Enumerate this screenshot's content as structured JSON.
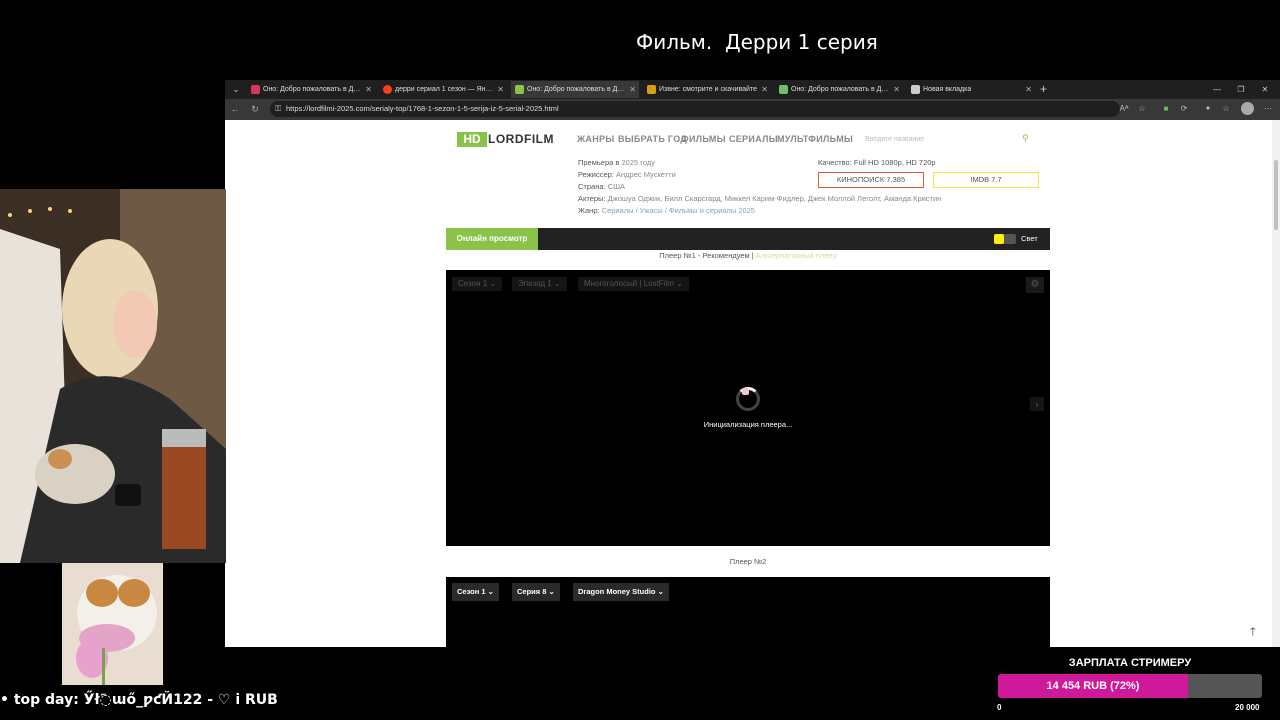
{
  "stream": {
    "title": "Фильм.  Дерри 1 серия",
    "top_day": "• top day: Ӳł߬ɯő_ƿƈЙ122 - ♡ i RUB"
  },
  "browser": {
    "tabs": [
      {
        "label": "Оно: Добро пожаловать в Дерри",
        "favicon_color": "#d9345a"
      },
      {
        "label": "дерри сериал 1 сезон — Яндекс",
        "favicon_color": "#fc3f1d"
      },
      {
        "label": "Оно: Добро пожаловать в Дерри",
        "favicon_color": "#8bc34a",
        "active": true
      },
      {
        "label": "Извне: смотрите и скачивайте",
        "favicon_color": "#d4a017"
      },
      {
        "label": "Оно: Добро пожаловать в Дерри",
        "favicon_color": "#6ec06e"
      },
      {
        "label": "Новая вкладка",
        "favicon_color": "#cccccc"
      }
    ],
    "url": "https://lordfilmi-2025.com/serialy-top/1768-1-sezon-1-5-serija-iz-5-serial-2025.html",
    "icons": [
      "back-icon",
      "reload-icon",
      "lock-icon",
      "reader-icon",
      "extension-icon",
      "refresh-icon",
      "extensions-icon",
      "favorites-icon",
      "profile-icon",
      "more-icon"
    ]
  },
  "site": {
    "logo_hd": "HD",
    "logo_text": "LORDFILM",
    "nav": [
      "ЖАНРЫ",
      "ВЫБРАТЬ ГОД",
      "ФИЛЬМЫ",
      "СЕРИАЛЫ",
      "МУЛЬТФИЛЬМЫ"
    ],
    "search_placeholder": "Введите название",
    "info": {
      "premiere_label": "Премьера в",
      "premiere_value": "2025 году",
      "director_label": "Режиссер:",
      "director_value": "Андрес Мускетти",
      "country_label": "Страна:",
      "country_value": "США",
      "actors_label": "Актеры:",
      "actors_value": "Джошуа Оджик, Билл Скарсгард, Миккел Карим-Фидлер, Джек Моллой Леголт, Аманда Кристин",
      "genre_label": "Жанр:",
      "genre_value": "Сериалы / Ужасы / Фильмы и сериалы 2025"
    },
    "quality": "Качество: Full HD 1080p, HD 720p",
    "kinopoisk": "КИНОПОИСК  7.385",
    "imdb": "IMDB  7.7",
    "online_label": "Онлайн просмотр",
    "light_label": "Свет",
    "player_tabs_main": "Плеер №1 - Рекомендуем |",
    "player_tabs_alt": "Альтернативный плеер",
    "player1": {
      "season": "Сезон 1",
      "episode": "Эпизод 1",
      "voice": "Многоголосый | LostFilm",
      "loading": "Инициализация плеера..."
    },
    "player2_label": "Плеер №2",
    "player2": {
      "season": "Сезон 1",
      "series": "Серия 8",
      "studio": "Dragon Money Studio"
    }
  },
  "goal": {
    "title": "ЗАРПЛАТА СТРИМЕРУ",
    "text": "14 454 RUB (72%)",
    "progress": 0.72,
    "min": "0",
    "max": "20 000"
  }
}
